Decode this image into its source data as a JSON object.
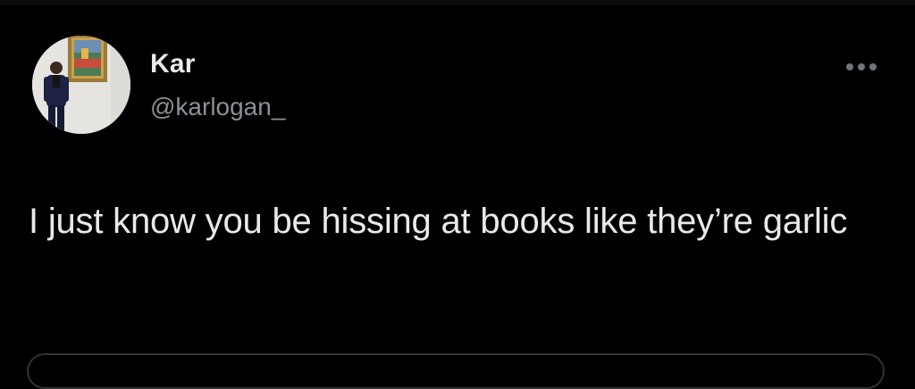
{
  "tweet": {
    "author": {
      "display_name": "Kar",
      "handle": "@karlogan_",
      "avatar_icon": "profile-photo"
    },
    "text": "I just know you be hissing at books like they’re garlic",
    "more_icon": "more-horizontal-icon"
  },
  "colors": {
    "background": "#000000",
    "primary_text": "#e7e9ea",
    "secondary_text": "#8b9096",
    "border": "#2f3336"
  }
}
